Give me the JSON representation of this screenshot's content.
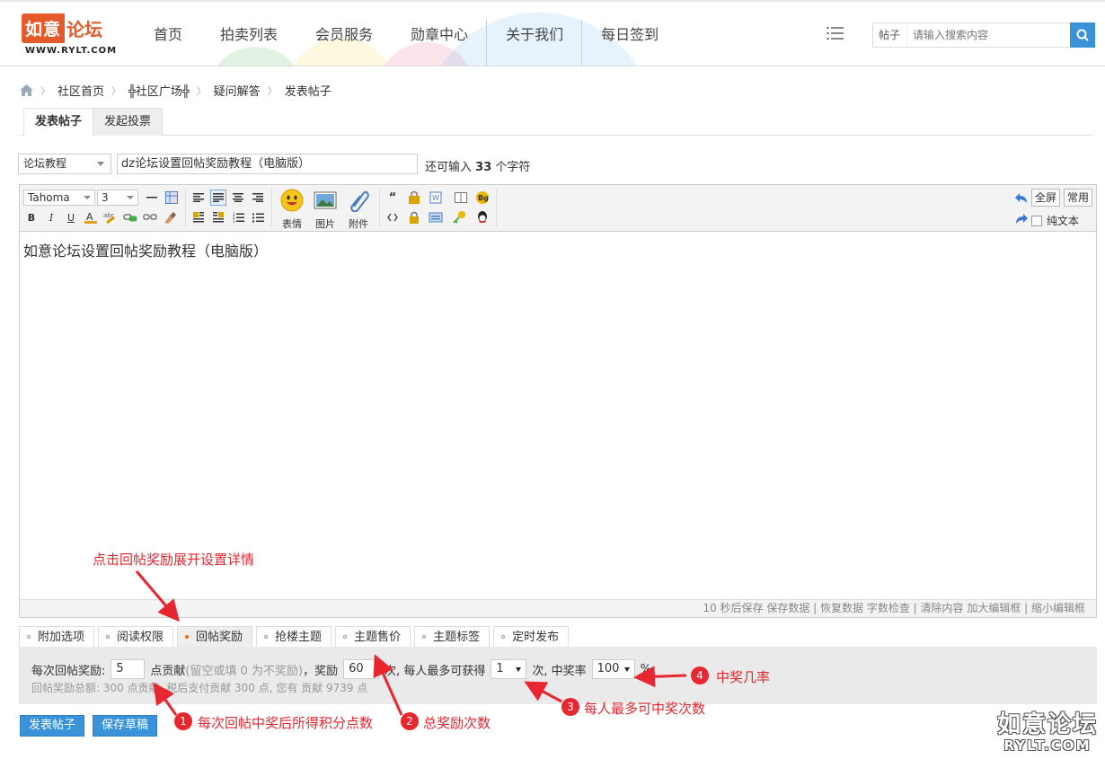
{
  "brand": {
    "logo_text_a": "如意",
    "logo_text_b": "论坛",
    "logo_url": "WWW.RYLT.COM"
  },
  "nav": {
    "items": [
      "首页",
      "拍卖列表",
      "会员服务",
      "勋章中心",
      "关于我们",
      "每日签到"
    ]
  },
  "search": {
    "type": "帖子",
    "placeholder": "请输入搜索内容"
  },
  "breadcrumb": [
    "社区首页",
    "╬社区广场╬",
    "疑问解答",
    "发表帖子"
  ],
  "post_tabs": [
    "发表帖子",
    "发起投票"
  ],
  "form": {
    "category": "论坛教程",
    "subject": "dz论坛设置回帖奖励教程（电脑版）",
    "remain_prefix": "还可输入",
    "remain_count": "33",
    "remain_suffix": "个字符"
  },
  "editor": {
    "font": "Tahoma",
    "size": "3",
    "big_buttons": [
      "表情",
      "图片",
      "附件"
    ],
    "fullscreen": "全屏",
    "common": "常用",
    "plaintext": "纯文本",
    "content": "如意论坛设置回帖奖励教程（电脑版）",
    "status": "10 秒后保存 保存数据 | 恢复数据    字数检查 | 清除内容    加大编辑框 | 缩小编辑框"
  },
  "option_tabs": [
    "附加选项",
    "阅读权限",
    "回帖奖励",
    "抢楼主题",
    "主题售价",
    "主题标签",
    "定时发布"
  ],
  "reward": {
    "label": "每次回帖奖励:",
    "points": "5",
    "unit": "点贡献",
    "hint": "(留空或填 0 为不奖励)",
    "comma": "，奖励",
    "times": "60",
    "times_text": "次, 每人最多可获得",
    "max": "1",
    "max_text": "次, 中奖率",
    "rate": "100",
    "percent": "%",
    "summary": "回帖奖励总额: 300 点贡献, 税后支付贡献 300 点, 您有 贡献 9739 点"
  },
  "buttons": {
    "submit": "发表帖子",
    "draft": "保存草稿"
  },
  "annotations": {
    "tip": "点击回帖奖励展开设置详情",
    "n1": "1",
    "t1": "每次回帖中奖后所得积分点数",
    "n2": "2",
    "t2": "总奖励次数",
    "n3": "3",
    "t3": "每人最多可中奖次数",
    "n4": "4",
    "t4": "中奖几率"
  },
  "watermark": {
    "line1": "如意论坛",
    "line2": "RYLT.COM"
  }
}
